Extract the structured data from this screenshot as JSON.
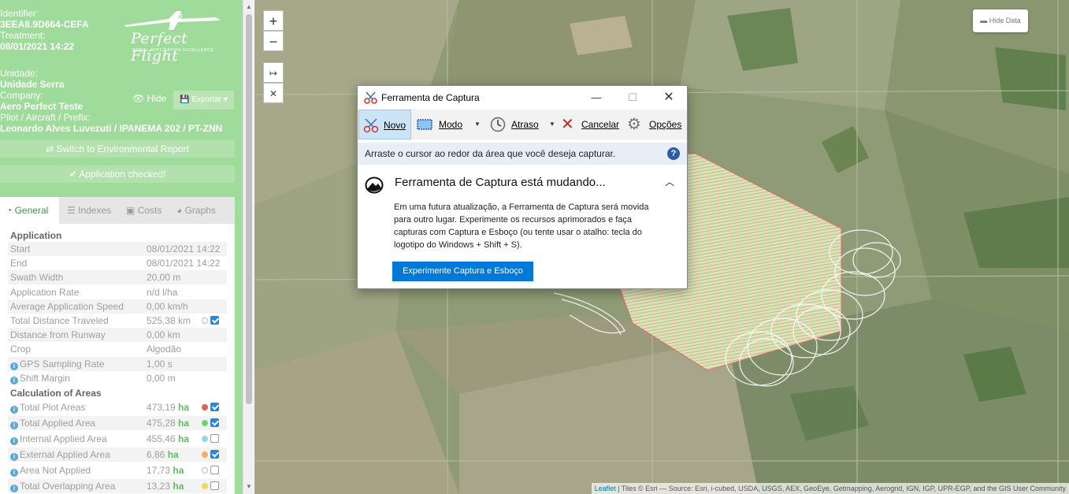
{
  "sidebar": {
    "identifier_label": "Identifier:",
    "identifier_value": "3EEA8.9D664-CEFA",
    "treatment_label": "Treatment:",
    "treatment_value": "08/01/2021 14:22",
    "unidade_label": "Unidade:",
    "unidade_value": "Unidade Serra",
    "company_label": "Company:",
    "company_value": "Aero Perfect Teste",
    "pilot_label": "Pilot / Aircraft / Prefix:",
    "pilot_value": "Leonardo Alves Luvezuti / IPANEMA 202 / PT-ZNN",
    "logo_text": "Perfect Flight",
    "logo_tagline": "AERIAL APPLICATION EXCELLENCE",
    "hide_label": "Hide",
    "export_label": "Exportar",
    "switch_label": "Switch to Environmental Report",
    "checked_label": "Application checked!",
    "tabs": [
      "General",
      "Indexes",
      "Costs",
      "Graphs"
    ],
    "section_application": "Application",
    "section_areas": "Calculation of Areas",
    "application_rows": [
      {
        "name": "Start",
        "value": "08/01/2021 14:22",
        "info": false
      },
      {
        "name": "End",
        "value": "08/01/2021 14:22",
        "info": false
      },
      {
        "name": "Swath Width",
        "value": "20,00 m",
        "info": false
      },
      {
        "name": "Application Rate",
        "value": "n/d l/ha",
        "info": false
      },
      {
        "name": "Average Application Speed",
        "value": "0,00 km/h",
        "info": false
      },
      {
        "name": "Total Distance Traveled",
        "value": "525,38 km",
        "info": false
      },
      {
        "name": "Distance from Runway",
        "value": "0,00 km",
        "info": false
      },
      {
        "name": "Crop",
        "value": "Algodão",
        "info": false
      },
      {
        "name": "GPS Sampling Rate",
        "value": "1,00 s",
        "info": true
      },
      {
        "name": "Shift Margin",
        "value": "0,00 m",
        "info": true
      }
    ],
    "area_rows": [
      {
        "name": "Total Plot Areas",
        "value": "473,19",
        "unit": "ha",
        "dot": "#e85c5c",
        "checked": true
      },
      {
        "name": "Total Applied Area",
        "value": "475,28",
        "unit": "ha",
        "dot": "#6ad66a",
        "checked": true
      },
      {
        "name": "Internal Applied Area",
        "value": "455,46",
        "unit": "ha",
        "dot": "#8fd8ef",
        "checked": false
      },
      {
        "name": "External Applied Area",
        "value": "6,86",
        "unit": "ha",
        "dot": "#f0b060",
        "checked": true
      },
      {
        "name": "Area Not Applied",
        "value": "17,73",
        "unit": "ha",
        "dot": "",
        "checked": false
      },
      {
        "name": "Total Overlapping Area",
        "value": "13,23",
        "unit": "ha",
        "dot": "#f2d65a",
        "checked": false
      }
    ]
  },
  "map": {
    "zoom_in": "+",
    "zoom_out": "−",
    "hide_data": "Hide Data",
    "attribution_link": "Leaflet",
    "attribution_text": " | Tiles © Esri — Source: Esri, i-cubed, USDA, USGS, AEX, GeoEye, Getmapping, Aerogrid, IGN, IGP, UPR-EGP, and the GIS User Community"
  },
  "dialog": {
    "title": "Ferramenta de Captura",
    "toolbar": {
      "novo": "Novo",
      "modo": "Modo",
      "atraso": "Atraso",
      "cancelar": "Cancelar",
      "opcoes": "Opções"
    },
    "hint": "Arraste o cursor ao redor da área que você deseja capturar.",
    "heading": "Ferramenta de Captura está mudando...",
    "body": "Em uma futura atualização, a Ferramenta de Captura será movida para outro lugar. Experimente os recursos aprimorados e faça capturas com Captura e Esboço (ou tente usar o atalho: tecla do logotipo do Windows + Shift + S).",
    "cta": "Experimente Captura e Esboço"
  }
}
